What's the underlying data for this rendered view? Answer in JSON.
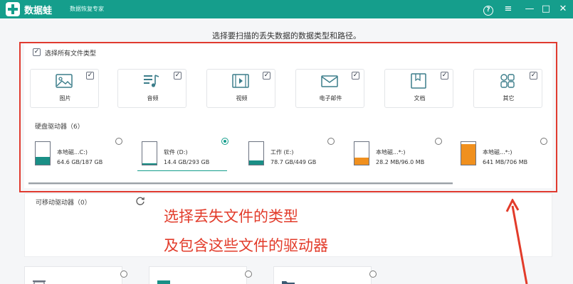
{
  "titlebar": {
    "app_name": "数据蛙",
    "app_subtitle": "数据恢复专家",
    "brand_color": "#159e8c",
    "icons": [
      "help-icon",
      "menu-icon",
      "minimize-icon",
      "maximize-icon",
      "close-icon"
    ],
    "menu_glyph": "≡",
    "minimize_glyph": "—",
    "maximize_glyph": "□",
    "close_glyph": "✕",
    "help_glyph": "?"
  },
  "instruction": "选择要扫描的丢失数据的数据类型和路径。",
  "select_all": {
    "label": "选择所有文件类型",
    "checked": true
  },
  "file_types": [
    {
      "label": "图片",
      "icon": "image-icon",
      "checked": true
    },
    {
      "label": "音频",
      "icon": "audio-icon",
      "checked": true
    },
    {
      "label": "视频",
      "icon": "video-icon",
      "checked": true
    },
    {
      "label": "电子邮件",
      "icon": "email-icon",
      "checked": true
    },
    {
      "label": "文档",
      "icon": "document-icon",
      "checked": true
    },
    {
      "label": "其它",
      "icon": "other-icon",
      "checked": true
    }
  ],
  "check_glyph": "✓",
  "hard_disks": {
    "label": "硬盘驱动器（6）",
    "drives": [
      {
        "name": "本地磁...C:)",
        "size": "64.6 GB/187 GB",
        "used_fraction": 0.35,
        "fill_color": "#1a8f86",
        "selected": false
      },
      {
        "name": "软件 (D:)",
        "size": "14.4 GB/293 GB",
        "used_fraction": 0.05,
        "fill_color": "#1a8f86",
        "selected": true
      },
      {
        "name": "工作 (E:)",
        "size": "78.7 GB/449 GB",
        "used_fraction": 0.18,
        "fill_color": "#1a8f86",
        "selected": false
      },
      {
        "name": "本地磁...*:)",
        "size": "28.2 MB/96.0 MB",
        "used_fraction": 0.3,
        "fill_color": "#f0901e",
        "selected": false
      },
      {
        "name": "本地磁...*:)",
        "size": "641 MB/706 MB",
        "used_fraction": 0.91,
        "fill_color": "#f0901e",
        "selected": false
      }
    ]
  },
  "removable": {
    "label": "可移动驱动器（0）",
    "refresh_icon": "refresh-icon"
  },
  "annotation": {
    "line1": "选择丢失文件的类型",
    "line2": "及包含这些文件的驱动器",
    "color": "#e23b2a"
  },
  "bottom_cards": [
    {
      "icon": "recycle-bin-icon"
    },
    {
      "icon": "desktop-icon"
    },
    {
      "icon": "folder-icon"
    }
  ]
}
